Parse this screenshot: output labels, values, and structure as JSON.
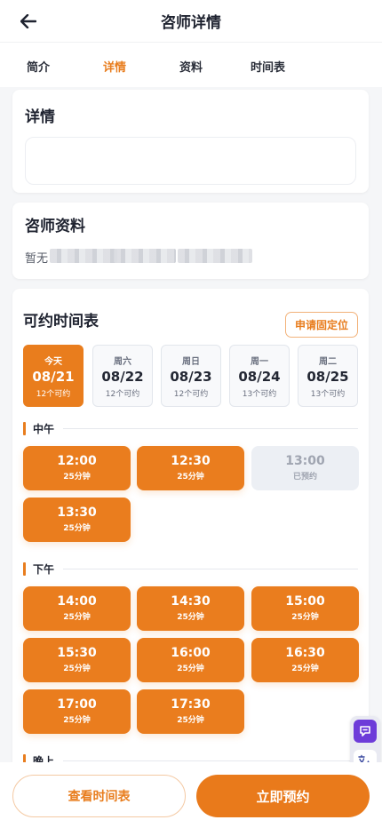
{
  "header": {
    "title": "咨师详情",
    "back_icon": "arrow-left-icon"
  },
  "tabs": [
    {
      "label": "简介",
      "active": false
    },
    {
      "label": "详情",
      "active": true
    },
    {
      "label": "资料",
      "active": false
    },
    {
      "label": "时间表",
      "active": false
    }
  ],
  "details": {
    "title": "详情"
  },
  "profile": {
    "title": "咨师资料",
    "text": "暂无"
  },
  "schedule": {
    "title": "可约时间表",
    "fixed_button": "申请固定位",
    "days": [
      {
        "name": "今天",
        "date": "08/21",
        "count": "12个可约",
        "active": true
      },
      {
        "name": "周六",
        "date": "08/22",
        "count": "12个可约",
        "active": false
      },
      {
        "name": "周日",
        "date": "08/23",
        "count": "12个可约",
        "active": false
      },
      {
        "name": "周一",
        "date": "08/24",
        "count": "13个可约",
        "active": false
      },
      {
        "name": "周二",
        "date": "08/25",
        "count": "13个可约",
        "active": false
      }
    ],
    "sections": [
      {
        "label": "中午",
        "slots": [
          {
            "time": "12:00",
            "status": "25分钟",
            "booked": false
          },
          {
            "time": "12:30",
            "status": "25分钟",
            "booked": false
          },
          {
            "time": "13:00",
            "status": "已预约",
            "booked": true
          },
          {
            "time": "13:30",
            "status": "25分钟",
            "booked": false
          }
        ]
      },
      {
        "label": "下午",
        "slots": [
          {
            "time": "14:00",
            "status": "25分钟",
            "booked": false
          },
          {
            "time": "14:30",
            "status": "25分钟",
            "booked": false
          },
          {
            "time": "15:00",
            "status": "25分钟",
            "booked": false
          },
          {
            "time": "15:30",
            "status": "25分钟",
            "booked": false
          },
          {
            "time": "16:00",
            "status": "25分钟",
            "booked": false
          },
          {
            "time": "16:30",
            "status": "25分钟",
            "booked": false
          },
          {
            "time": "17:00",
            "status": "25分钟",
            "booked": false
          },
          {
            "time": "17:30",
            "status": "25分钟",
            "booked": false
          }
        ]
      },
      {
        "label": "晚上",
        "slots": []
      }
    ]
  },
  "bottom": {
    "view_schedule": "查看时间表",
    "book_now": "立即预约"
  },
  "colors": {
    "accent": "#E87D1E",
    "booked_bg": "#ECEFF4",
    "tool_purple": "#6D3BD9"
  }
}
